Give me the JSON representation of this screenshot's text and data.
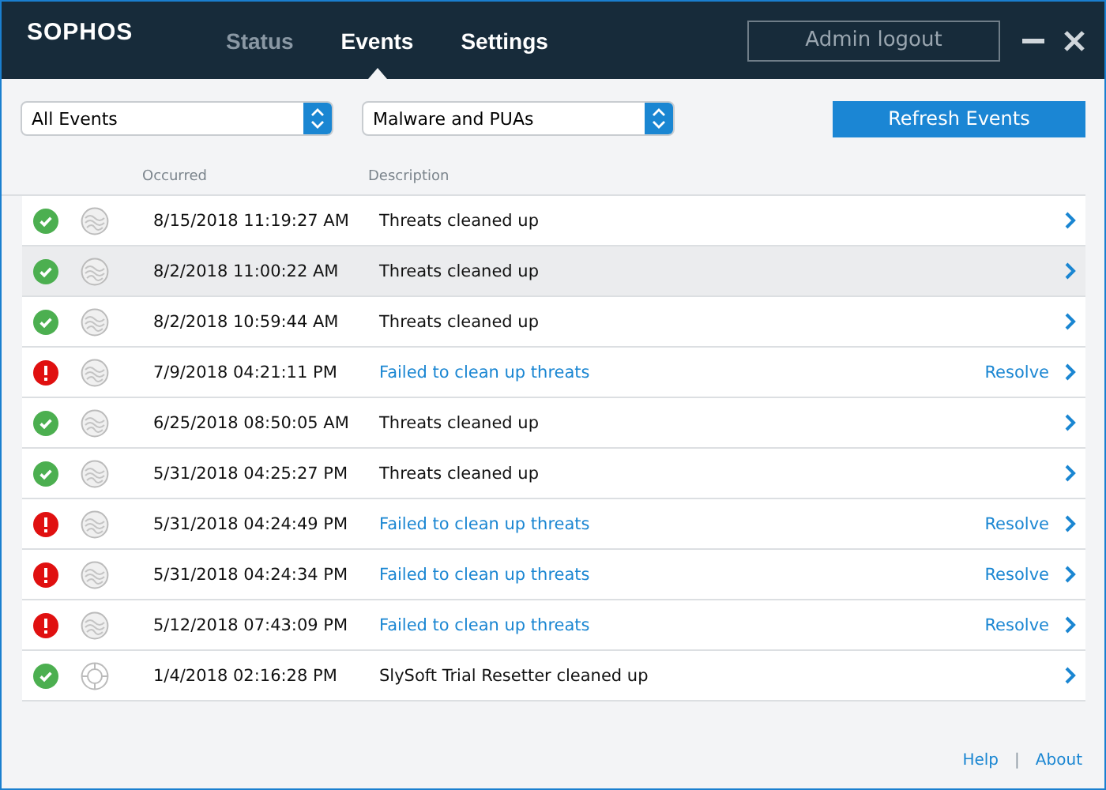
{
  "header": {
    "logo": "SOPHOS",
    "tabs": [
      {
        "label": "Status",
        "selected": false,
        "disabled": true
      },
      {
        "label": "Events",
        "selected": true,
        "disabled": false
      },
      {
        "label": "Settings",
        "selected": false,
        "disabled": false
      }
    ],
    "logout_button": "Admin logout"
  },
  "toolbar": {
    "filters": [
      {
        "value": "All Events"
      },
      {
        "value": "Malware and PUAs"
      }
    ],
    "refresh_button": "Refresh Events"
  },
  "table": {
    "columns": [
      "Occurred",
      "Description"
    ],
    "rows": [
      {
        "status": {
          "kind": "ok"
        },
        "type_icon": {
          "kind": "wave"
        },
        "occurred": "8/15/2018 11:19:27 AM",
        "description": "Threats cleaned up",
        "selected": false
      },
      {
        "status": {
          "kind": "ok"
        },
        "type_icon": {
          "kind": "wave"
        },
        "occurred": "8/2/2018 11:00:22 AM",
        "description": "Threats cleaned up",
        "selected": true
      },
      {
        "status": {
          "kind": "ok"
        },
        "type_icon": {
          "kind": "wave"
        },
        "occurred": "8/2/2018 10:59:44 AM",
        "description": "Threats cleaned up",
        "selected": false
      },
      {
        "status": {
          "kind": "error"
        },
        "type_icon": {
          "kind": "wave"
        },
        "occurred": "7/9/2018 04:21:11 PM",
        "description": "Failed to clean up threats",
        "action": "Resolve",
        "selected": false
      },
      {
        "status": {
          "kind": "ok"
        },
        "type_icon": {
          "kind": "wave"
        },
        "occurred": "6/25/2018 08:50:05 AM",
        "description": "Threats cleaned up",
        "selected": false
      },
      {
        "status": {
          "kind": "ok"
        },
        "type_icon": {
          "kind": "wave"
        },
        "occurred": "5/31/2018 04:25:27 PM",
        "description": "Threats cleaned up",
        "selected": false
      },
      {
        "status": {
          "kind": "error"
        },
        "type_icon": {
          "kind": "wave"
        },
        "occurred": "5/31/2018 04:24:49 PM",
        "description": "Failed to clean up threats",
        "action": "Resolve",
        "selected": false
      },
      {
        "status": {
          "kind": "error"
        },
        "type_icon": {
          "kind": "wave"
        },
        "occurred": "5/31/2018 04:24:34 PM",
        "description": "Failed to clean up threats",
        "action": "Resolve",
        "selected": false
      },
      {
        "status": {
          "kind": "error"
        },
        "type_icon": {
          "kind": "wave"
        },
        "occurred": "5/12/2018 07:43:09 PM",
        "description": "Failed to clean up threats",
        "action": "Resolve",
        "selected": false
      },
      {
        "status": {
          "kind": "ok"
        },
        "type_icon": {
          "kind": "target"
        },
        "occurred": "1/4/2018 02:16:28 PM",
        "description": "SlySoft Trial Resetter cleaned up",
        "selected": false
      }
    ]
  },
  "footer": {
    "links": [
      "Help",
      "About"
    ],
    "separator": "|"
  }
}
